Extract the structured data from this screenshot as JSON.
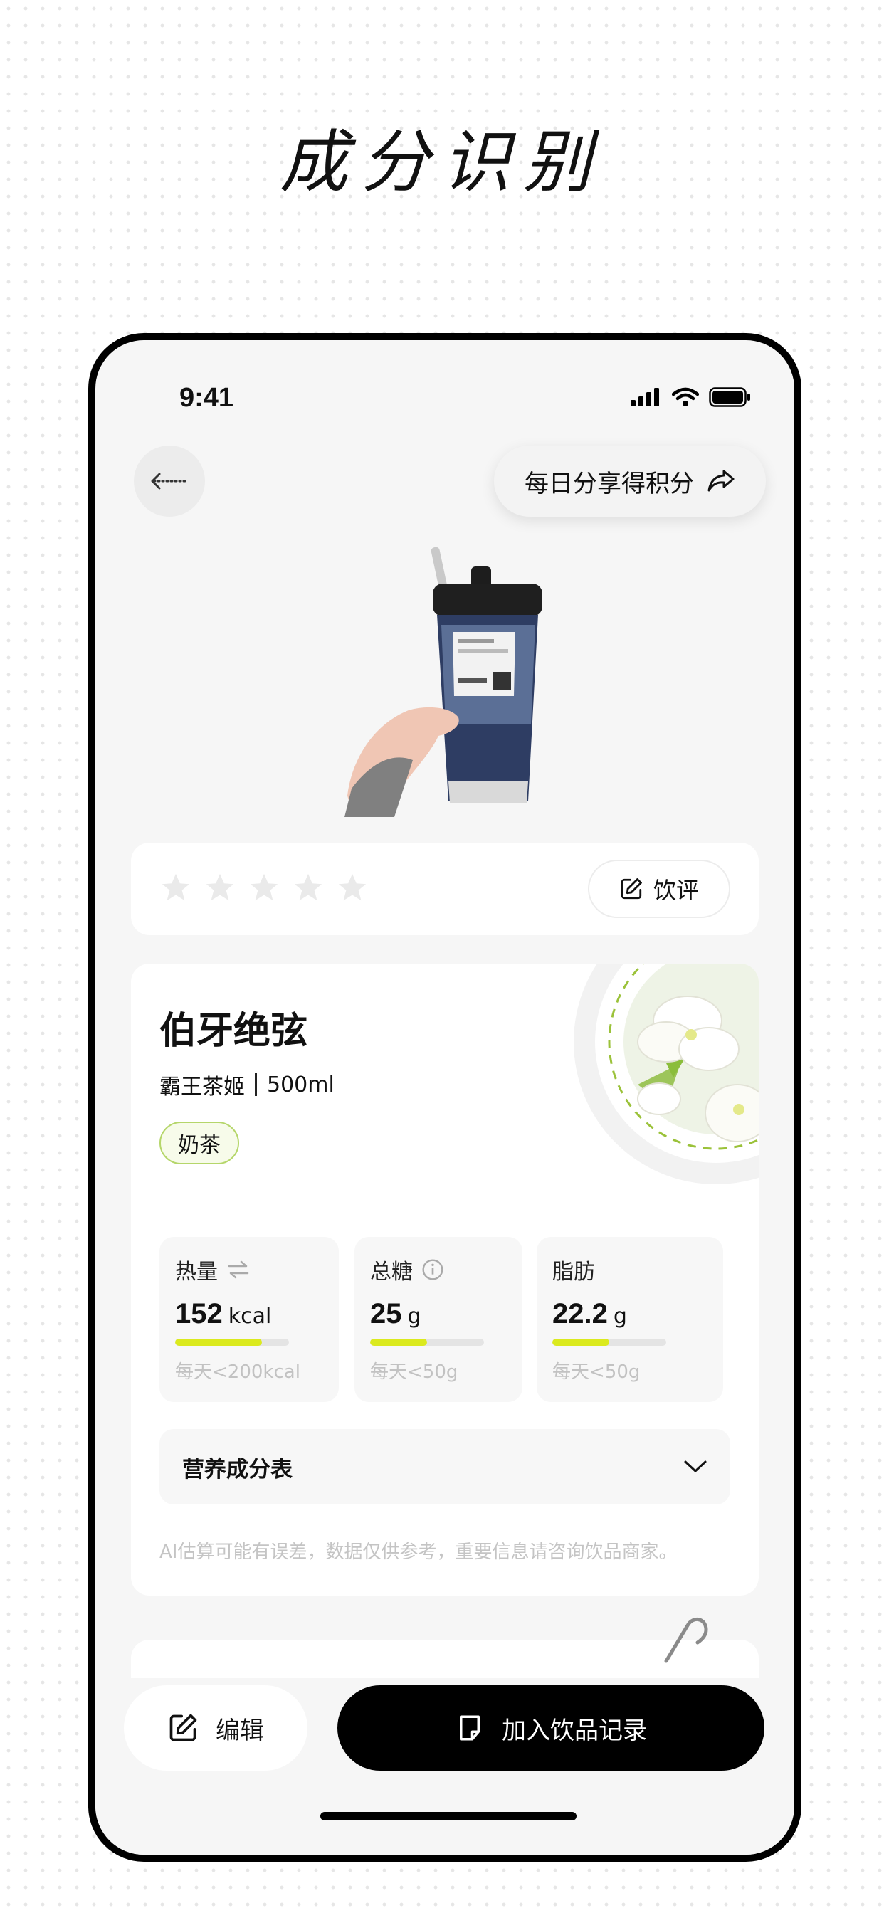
{
  "page": {
    "title": "成分识别"
  },
  "status_bar": {
    "time": "9:41"
  },
  "header": {
    "share_label": "每日分享得积分"
  },
  "rating": {
    "stars_filled": 0,
    "stars_total": 5,
    "review_label": "饮评"
  },
  "drink": {
    "name": "伯牙绝弦",
    "brand": "霸王茶姬",
    "volume": "500ml",
    "tag": "奶茶"
  },
  "stats": [
    {
      "label": "热量",
      "value": "152",
      "unit": "kcal",
      "limit": "每天<200kcal",
      "fill": 0.76,
      "icon": "swap-icon"
    },
    {
      "label": "总糖",
      "value": "25",
      "unit": "g",
      "limit": "每天<50g",
      "fill": 0.5,
      "icon": "info-icon"
    },
    {
      "label": "脂肪",
      "value": "22.2",
      "unit": "g",
      "limit": "每天<50g",
      "fill": 0.5
    }
  ],
  "nutrition_table": {
    "label": "营养成分表"
  },
  "disclaimer": "AI估算可能有误差，数据仅供参考，重要信息请咨询饮品商家。",
  "actions": {
    "edit_label": "编辑",
    "add_label": "加入饮品记录"
  },
  "colors": {
    "accent": "#dbea1e",
    "tag_border": "#b5d66a",
    "primary": "#000000"
  }
}
